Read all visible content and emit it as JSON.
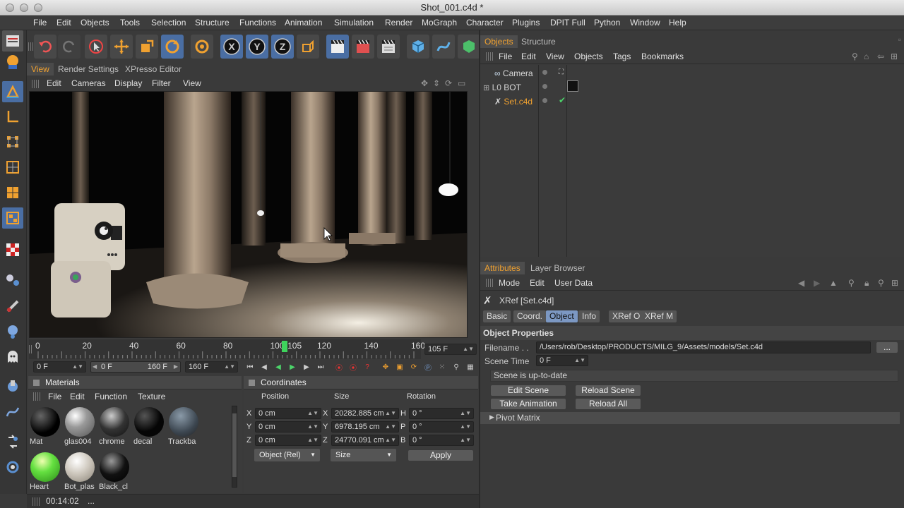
{
  "window": {
    "title": "Shot_001.c4d *"
  },
  "menubar": [
    "File",
    "Edit",
    "Objects",
    "Tools",
    "Selection",
    "Structure",
    "Functions",
    "Animation",
    "Simulation",
    "Render",
    "MoGraph",
    "Character",
    "Plugins",
    "DPIT Full",
    "Python",
    "Window",
    "Help"
  ],
  "viewport": {
    "tabs": [
      "View",
      "Render Settings",
      "XPresso Editor"
    ],
    "menu": [
      "Edit",
      "Cameras",
      "Display",
      "Filter",
      "View"
    ]
  },
  "timeline": {
    "labels": [
      "0",
      "20",
      "40",
      "60",
      "80",
      "100",
      "105",
      "120",
      "140",
      "160"
    ],
    "current": 105,
    "max": 160,
    "current_field": "105 F"
  },
  "playback": {
    "start": "0 F",
    "range_start": "0 F",
    "range_end": "160 F",
    "end": "160 F"
  },
  "materials": {
    "title": "Materials",
    "menu": [
      "File",
      "Edit",
      "Function",
      "Texture"
    ],
    "items": [
      {
        "name": "Mat"
      },
      {
        "name": "glas004"
      },
      {
        "name": "chrome"
      },
      {
        "name": "decal"
      },
      {
        "name": "Trackba"
      },
      {
        "name": "Heart"
      },
      {
        "name": "Bot_plas"
      },
      {
        "name": "Black_cl"
      }
    ]
  },
  "coordinates": {
    "title": "Coordinates",
    "columns": [
      "Position",
      "Size",
      "Rotation"
    ],
    "rows": [
      {
        "axis": "X",
        "pos": "0 cm",
        "saxis": "X",
        "size": "20282.885 cm",
        "raxis": "H",
        "rot": "0 °"
      },
      {
        "axis": "Y",
        "pos": "0 cm",
        "saxis": "Y",
        "size": "6978.195 cm",
        "raxis": "P",
        "rot": "0 °"
      },
      {
        "axis": "Z",
        "pos": "0 cm",
        "saxis": "Z",
        "size": "24770.091 cm",
        "raxis": "B",
        "rot": "0 °"
      }
    ],
    "mode": "Object (Rel)",
    "size_mode": "Size",
    "apply": "Apply"
  },
  "objects": {
    "tabs": [
      "Objects",
      "Structure"
    ],
    "menu": [
      "File",
      "Edit",
      "View",
      "Objects",
      "Tags",
      "Bookmarks"
    ],
    "items": [
      {
        "name": "Camera"
      },
      {
        "name": "BOT"
      },
      {
        "name": "Set.c4d"
      }
    ]
  },
  "attributes": {
    "tabs": [
      "Attributes",
      "Layer Browser"
    ],
    "menu": [
      "Mode",
      "Edit",
      "User Data"
    ],
    "object_title": "XRef [Set.c4d]",
    "subtabs": [
      "Basic",
      "Coord.",
      "Object",
      "Info",
      "XRef O",
      "XRef M"
    ],
    "section": "Object Properties",
    "filename_label": "Filename . .",
    "filename": "/Users/rob/Desktop/PRODUCTS/MILG_9/Assets/models/Set.c4d",
    "browse": "...",
    "scene_time_label": "Scene Time",
    "scene_time": "0 F",
    "status": "Scene is up-to-date",
    "buttons": [
      "Edit Scene",
      "Reload Scene",
      "Take Animation",
      "Reload All"
    ],
    "pivot": "Pivot Matrix"
  },
  "statusbar": {
    "time": "00:14:02",
    "extra": "..."
  },
  "colors": {
    "accent": "#f0a130",
    "selected_tab": "#7c98c3",
    "active_tool": "#4a6ea3"
  }
}
